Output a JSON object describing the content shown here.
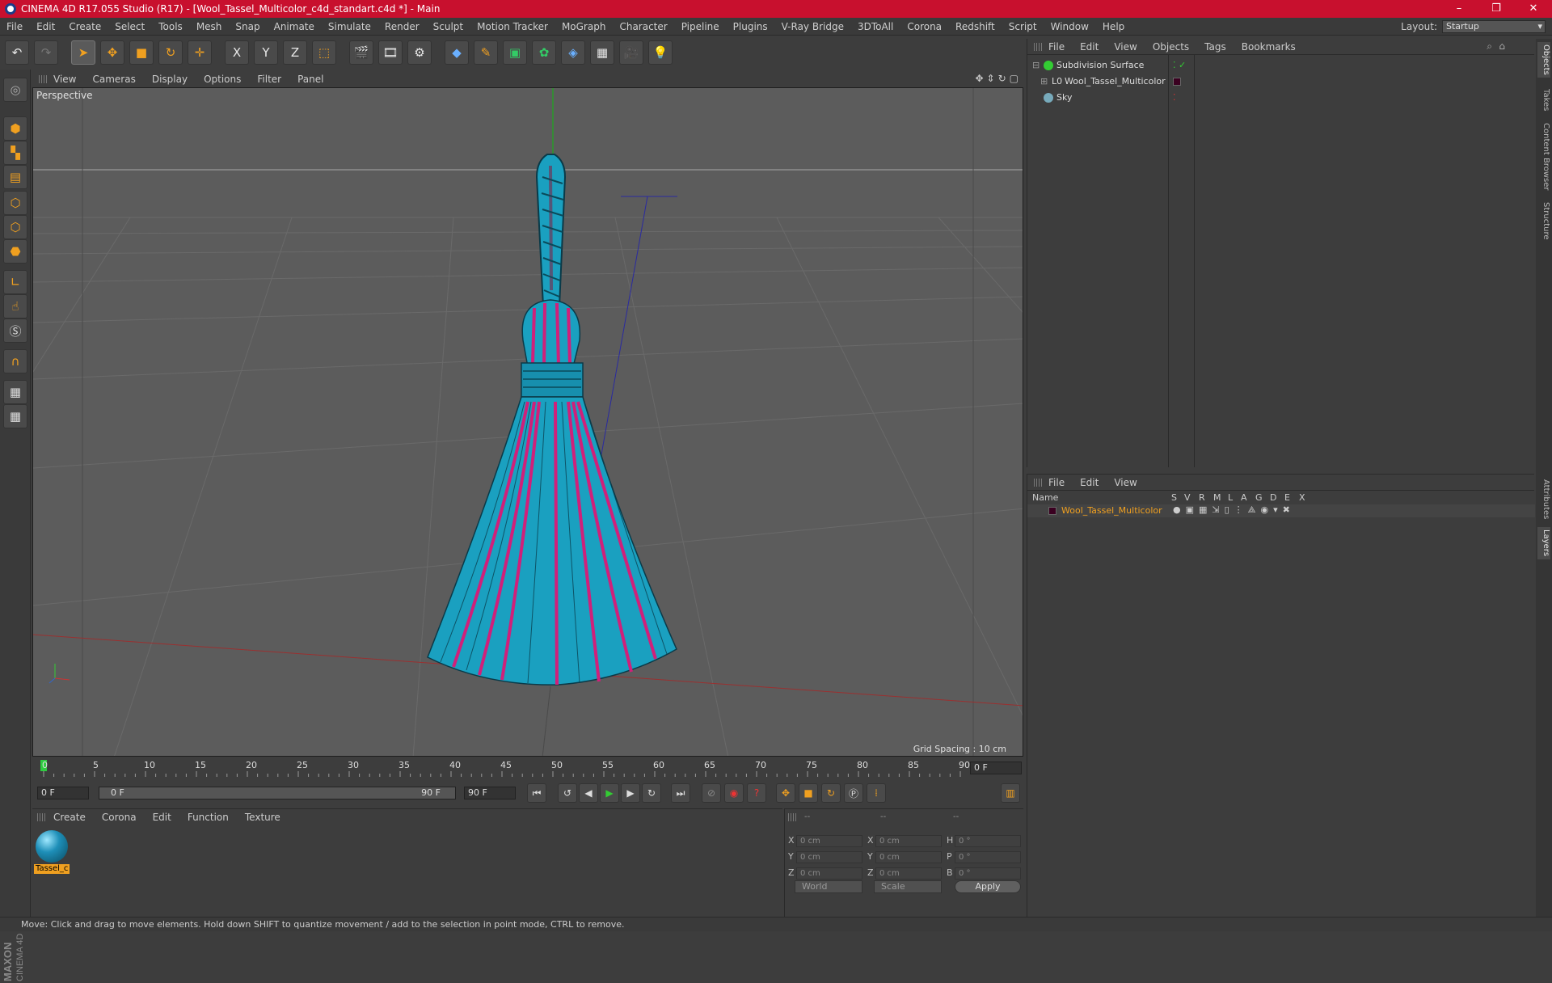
{
  "window": {
    "title": "CINEMA 4D R17.055 Studio (R17) - [Wool_Tassel_Multicolor_c4d_standart.c4d *] - Main",
    "buttons": [
      "–",
      "❐",
      "✕"
    ]
  },
  "menubar": {
    "items": [
      "File",
      "Edit",
      "Create",
      "Select",
      "Tools",
      "Mesh",
      "Snap",
      "Animate",
      "Simulate",
      "Render",
      "Sculpt",
      "Motion Tracker",
      "MoGraph",
      "Character",
      "Pipeline",
      "Plugins",
      "V-Ray Bridge",
      "3DToAll",
      "Corona",
      "Redshift",
      "Script",
      "Window",
      "Help"
    ],
    "layout_label": "Layout:",
    "layout_value": "Startup"
  },
  "toolbar": {
    "axis_x": "X",
    "axis_y": "Y",
    "axis_z": "Z"
  },
  "viewport": {
    "menu": [
      "View",
      "Cameras",
      "Display",
      "Options",
      "Filter",
      "Panel"
    ],
    "label": "Perspective",
    "grid_spacing": "Grid Spacing : 10 cm"
  },
  "timeline": {
    "ticks": [
      "0",
      "5",
      "10",
      "15",
      "20",
      "25",
      "30",
      "35",
      "40",
      "45",
      "50",
      "55",
      "60",
      "65",
      "70",
      "75",
      "80",
      "85",
      "90"
    ],
    "current_frame": "0 F",
    "start_frame": "0 F",
    "range_start": "0 F",
    "range_end": "90 F",
    "end_frame": "90 F"
  },
  "materials": {
    "menu": [
      "Create",
      "Corona",
      "Edit",
      "Function",
      "Texture"
    ],
    "items": [
      {
        "name": "Tassel_c"
      }
    ]
  },
  "coordinates": {
    "header": [
      "--",
      "--",
      "--"
    ],
    "rows": [
      {
        "a": "X",
        "av": "0 cm",
        "b": "X",
        "bv": "0 cm",
        "c": "H",
        "cv": "0 °"
      },
      {
        "a": "Y",
        "av": "0 cm",
        "b": "Y",
        "bv": "0 cm",
        "c": "P",
        "cv": "0 °"
      },
      {
        "a": "Z",
        "av": "0 cm",
        "b": "Z",
        "bv": "0 cm",
        "c": "B",
        "cv": "0 °"
      }
    ],
    "mode_world": "World",
    "mode_scale": "Scale",
    "apply": "Apply"
  },
  "object_manager": {
    "menu": [
      "File",
      "Edit",
      "View",
      "Objects",
      "Tags",
      "Bookmarks"
    ],
    "objects": [
      {
        "name": "Subdivision Surface",
        "icon": "subdivision-icon"
      },
      {
        "name": "Wool_Tassel_Multicolor",
        "icon": "null-object-icon"
      },
      {
        "name": "Sky",
        "icon": "sky-icon"
      }
    ]
  },
  "layer_manager": {
    "menu": [
      "File",
      "Edit",
      "View"
    ],
    "columns": [
      "Name",
      "S",
      "V",
      "R",
      "M",
      "L",
      "A",
      "G",
      "D",
      "E",
      "X"
    ],
    "layers": [
      {
        "name": "Wool_Tassel_Multicolor"
      }
    ]
  },
  "right_tabs": [
    "Objects",
    "Takes",
    "Content Browser",
    "Structure",
    "Attributes",
    "Layers"
  ],
  "status": {
    "text": "Move: Click and drag to move elements. Hold down SHIFT to quantize movement / add to the selection in point mode, CTRL to remove."
  },
  "colors": {
    "title_bar": "#c8102e",
    "accent": "#f0a020",
    "tassel_teal": "#1aa0c0",
    "tassel_magenta": "#d0207a"
  }
}
